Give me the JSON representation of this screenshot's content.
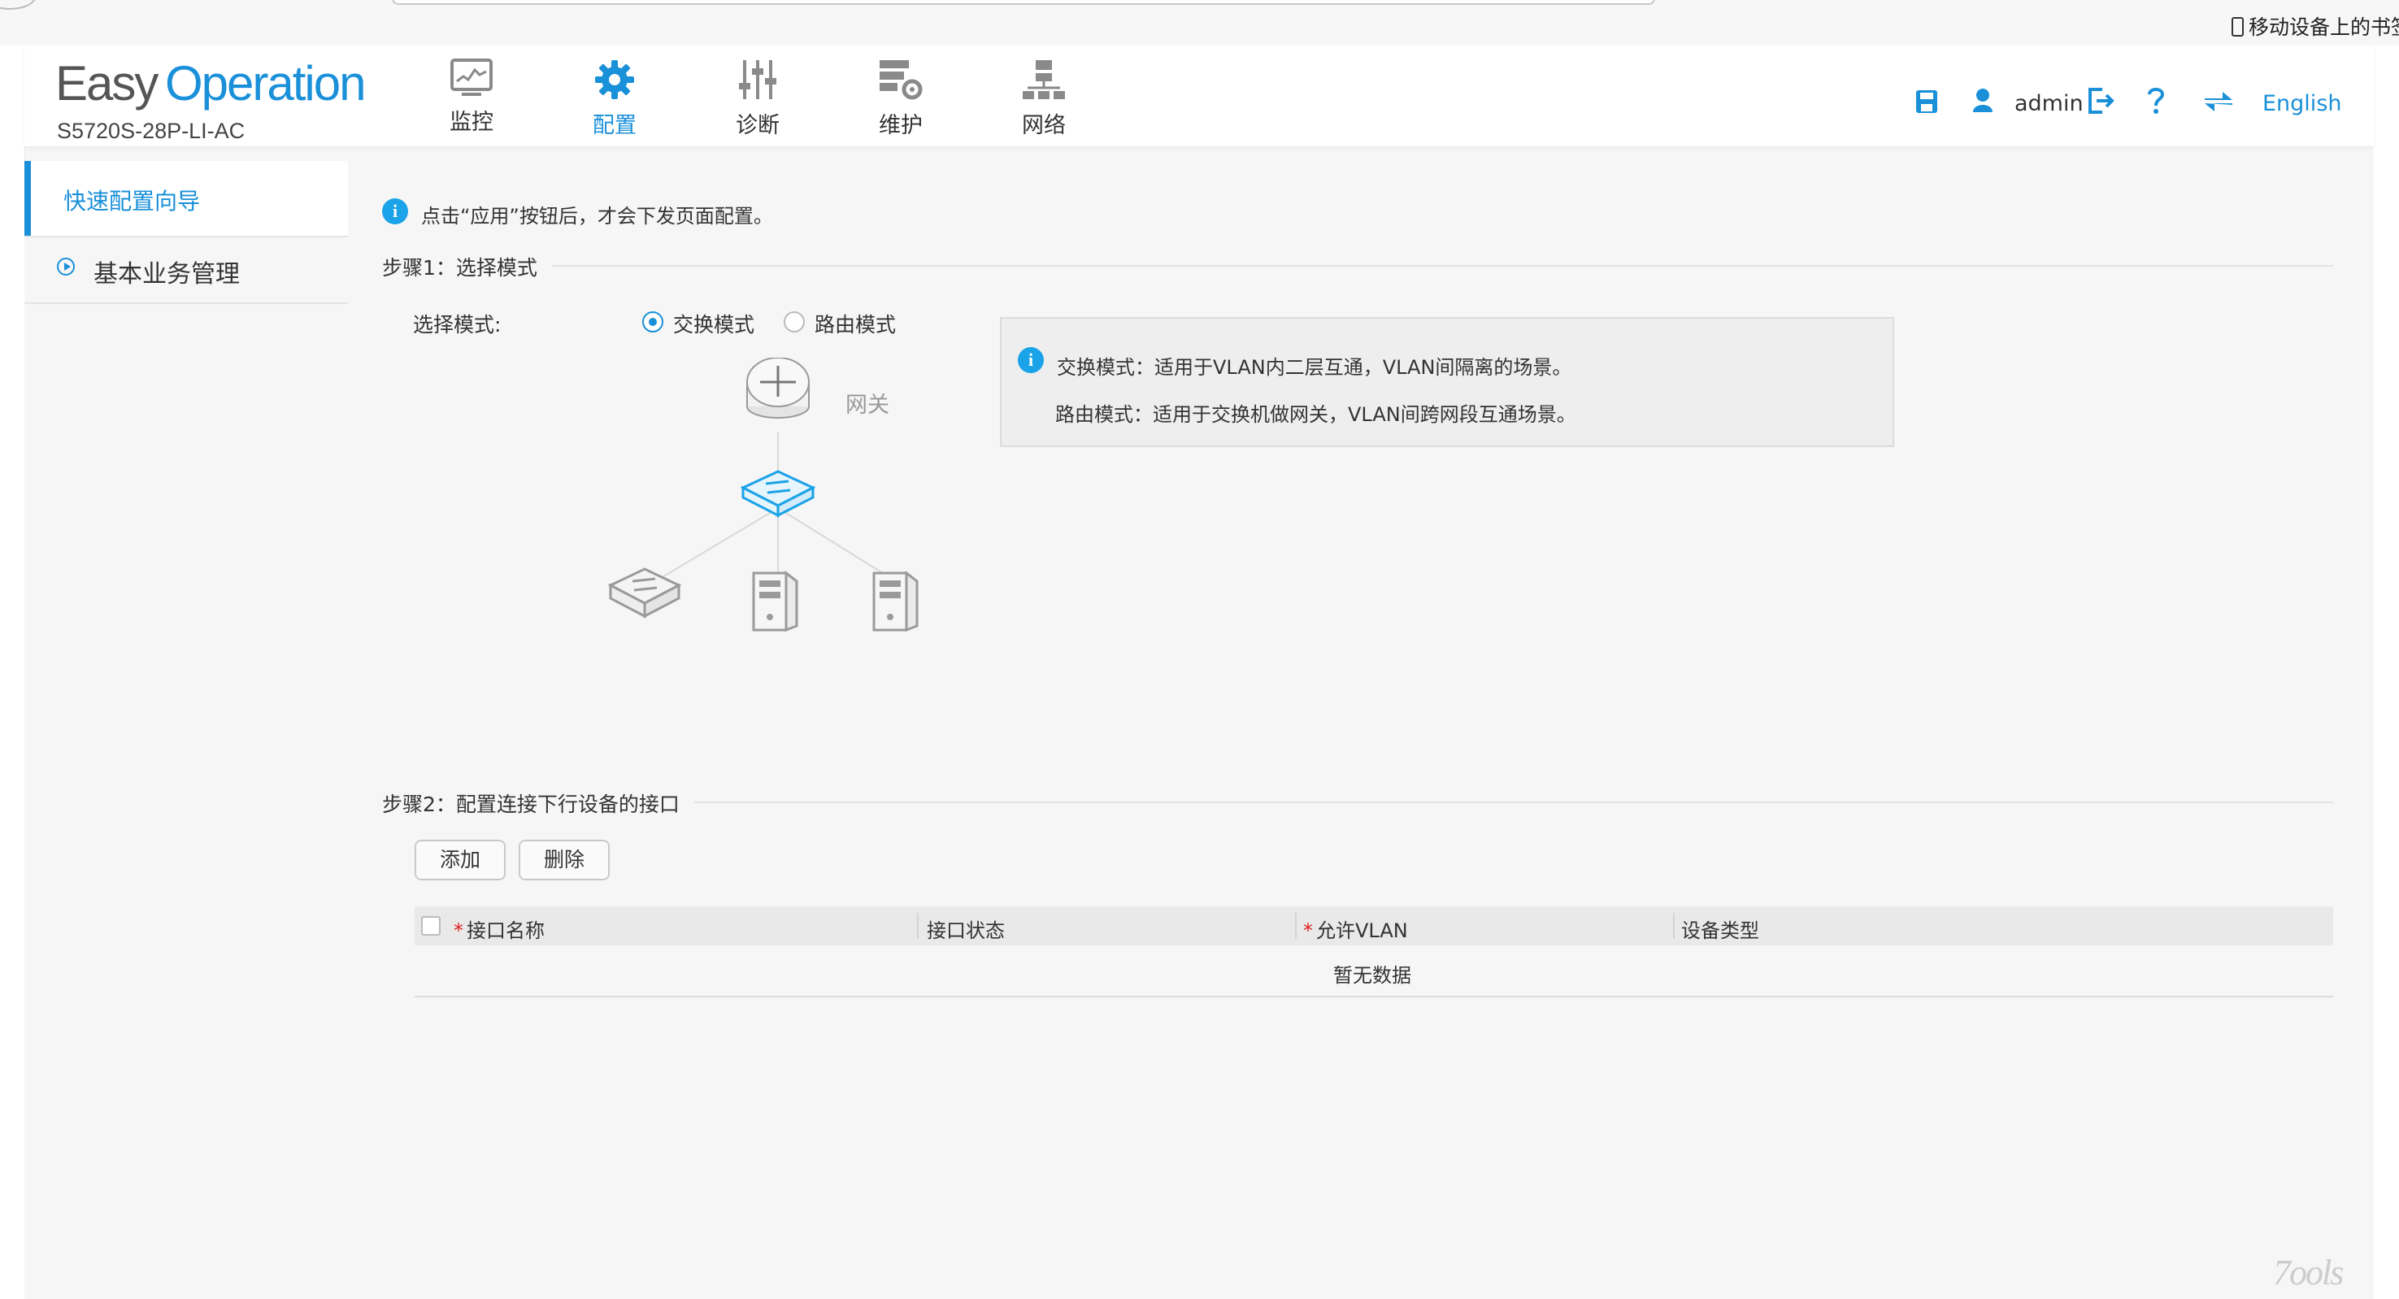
{
  "browser": {
    "bookmark_label": "移动设备上的书签"
  },
  "header": {
    "logo_part1": "Easy",
    "logo_part2": "Operation",
    "model": "S5720S-28P-LI-AC",
    "nav": [
      {
        "label": "监控",
        "icon": "monitor-icon"
      },
      {
        "label": "配置",
        "icon": "gear-icon",
        "active": true
      },
      {
        "label": "诊断",
        "icon": "sliders-icon"
      },
      {
        "label": "维护",
        "icon": "maintenance-icon"
      },
      {
        "label": "网络",
        "icon": "network-icon"
      }
    ],
    "user": "admin",
    "language": "English"
  },
  "sidebar": {
    "items": [
      {
        "label": "快速配置向导",
        "active": true
      },
      {
        "label": "基本业务管理"
      }
    ]
  },
  "main": {
    "notice": "点击“应用”按钮后，才会下发页面配置。",
    "step1": {
      "title": "步骤1：选择模式",
      "mode_label": "选择模式:",
      "options": [
        {
          "label": "交换模式",
          "checked": true
        },
        {
          "label": "路由模式",
          "checked": false
        }
      ],
      "diagram_gateway_label": "网关",
      "info_lines": [
        "交换模式：适用于VLAN内二层互通，VLAN间隔离的场景。",
        "路由模式：适用于交换机做网关，VLAN间跨网段互通场景。"
      ]
    },
    "step2": {
      "title": "步骤2：配置连接下行设备的接口",
      "add_button": "添加",
      "delete_button": "删除",
      "columns": [
        {
          "label": "接口名称",
          "required": "*"
        },
        {
          "label": "接口状态",
          "required": ""
        },
        {
          "label": "允许VLAN",
          "required": "*"
        },
        {
          "label": "设备类型",
          "required": ""
        }
      ],
      "empty_text": "暂无数据"
    }
  },
  "watermark": "7ools",
  "colors": {
    "accent": "#1a90d9",
    "info": "#1aa3e8",
    "required": "#e02020"
  }
}
